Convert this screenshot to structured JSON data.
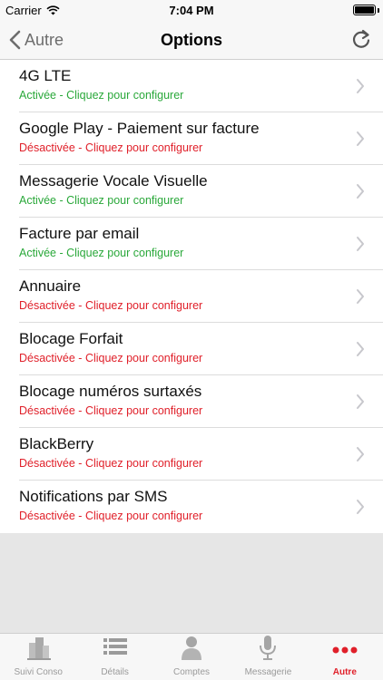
{
  "status_bar": {
    "carrier": "Carrier",
    "time": "7:04 PM"
  },
  "nav": {
    "back_label": "Autre",
    "title": "Options"
  },
  "options": [
    {
      "title": "4G LTE",
      "status": "Activée - Cliquez pour configurer",
      "enabled": true
    },
    {
      "title": "Google Play - Paiement sur facture",
      "status": "Désactivée - Cliquez pour configurer",
      "enabled": false
    },
    {
      "title": "Messagerie Vocale Visuelle",
      "status": "Activée - Cliquez pour configurer",
      "enabled": true
    },
    {
      "title": "Facture par email",
      "status": "Activée - Cliquez pour configurer",
      "enabled": true
    },
    {
      "title": "Annuaire",
      "status": "Désactivée - Cliquez pour configurer",
      "enabled": false
    },
    {
      "title": "Blocage Forfait",
      "status": "Désactivée - Cliquez pour configurer",
      "enabled": false
    },
    {
      "title": "Blocage numéros surtaxés",
      "status": "Désactivée - Cliquez pour configurer",
      "enabled": false
    },
    {
      "title": "BlackBerry",
      "status": "Désactivée - Cliquez pour configurer",
      "enabled": false
    },
    {
      "title": "Notifications par SMS",
      "status": "Désactivée - Cliquez pour configurer",
      "enabled": false
    }
  ],
  "tabs": [
    {
      "label": "Suivi Conso",
      "icon": "buildings-icon",
      "active": false
    },
    {
      "label": "Détails",
      "icon": "list-icon",
      "active": false
    },
    {
      "label": "Comptes",
      "icon": "person-icon",
      "active": false
    },
    {
      "label": "Messagerie",
      "icon": "microphone-icon",
      "active": false
    },
    {
      "label": "Autre",
      "icon": "more-dots-icon",
      "active": true
    }
  ],
  "colors": {
    "enabled": "#2aa83a",
    "disabled": "#e0202a",
    "accent": "#e0202a"
  }
}
